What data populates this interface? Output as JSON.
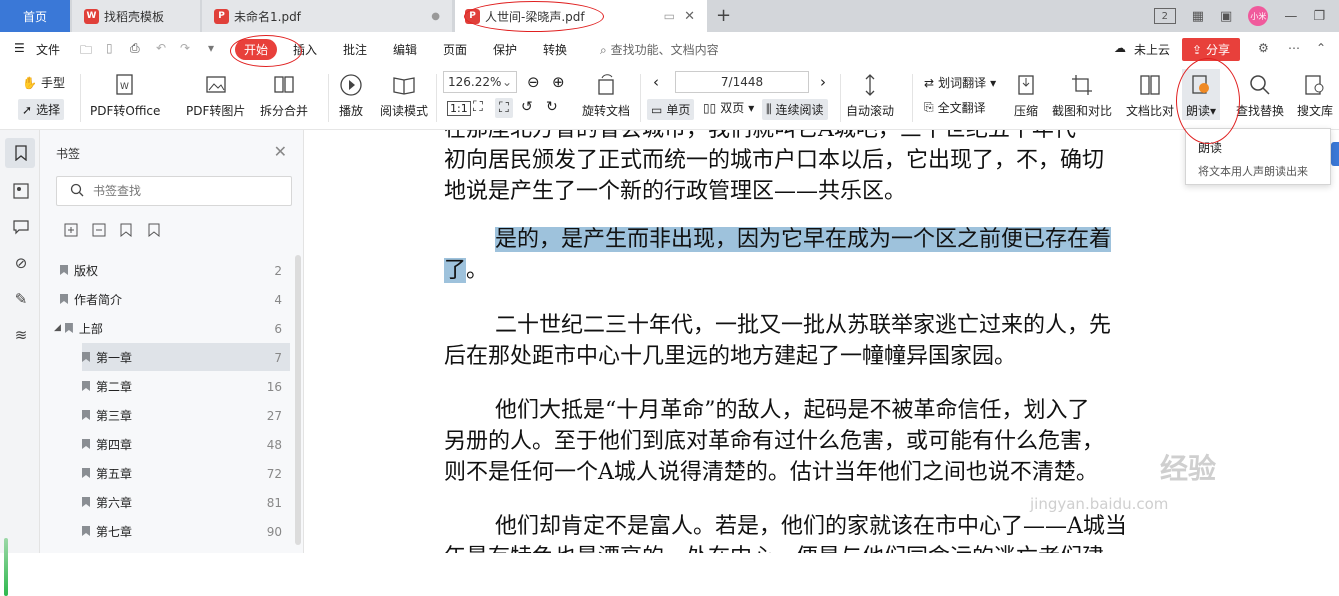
{
  "tabs": {
    "home": "首页",
    "t1": "找稻壳模板",
    "t2": "未命名1.pdf",
    "t3": "人世间-梁晓声.pdf",
    "t1_icon": "W",
    "t2_icon": "P",
    "t3_icon": "P",
    "avatar_text": "小米",
    "page_count_badge": "2"
  },
  "menubar": {
    "file": "文件",
    "start": "开始",
    "insert": "插入",
    "annotate": "批注",
    "edit": "编辑",
    "page": "页面",
    "protect": "保护",
    "convert": "转换",
    "search": "查找功能、文档内容",
    "cloud": "未上云",
    "share": "分享"
  },
  "ribbon": {
    "hand": "手型",
    "select": "选择",
    "pdf_office": "PDF转Office",
    "pdf_image": "PDF转图片",
    "split_merge": "拆分合并",
    "play": "播放",
    "reading_mode": "阅读模式",
    "zoom": "126.22%",
    "rotate_doc": "旋转文档",
    "page_indicator": "7/1448",
    "single_page": "单页",
    "double_page": "双页",
    "continuous": "连续阅读",
    "auto_scroll": "自动滚动",
    "word_translate": "划词翻译",
    "full_translate": "全文翻译",
    "compress": "压缩",
    "screenshot_compare": "截图和对比",
    "text_compare": "文档比对",
    "read_aloud": "朗读",
    "find_replace": "查找替换",
    "search_lib": "搜文库"
  },
  "tooltip": {
    "title": "朗读",
    "desc": "将文本用人声朗读出来"
  },
  "sidepanel": {
    "title": "书签",
    "search_placeholder": "书签查找",
    "items": [
      {
        "label": "版权",
        "page": "2"
      },
      {
        "label": "作者简介",
        "page": "4"
      },
      {
        "label": "上部",
        "page": "6"
      },
      {
        "label": "第一章",
        "page": "7"
      },
      {
        "label": "第二章",
        "page": "16"
      },
      {
        "label": "第三章",
        "page": "27"
      },
      {
        "label": "第四章",
        "page": "48"
      },
      {
        "label": "第五章",
        "page": "72"
      },
      {
        "label": "第六章",
        "page": "81"
      },
      {
        "label": "第七章",
        "page": "90"
      }
    ]
  },
  "document": {
    "p0a": "在那座北方省的省会城市，我们就叫它A城吧，三十世纪五十年代",
    "p0b": "初向居民颁发了正式而统一的城市户口本以后，它出现了，不，确切",
    "p0c": "地说是产生了一个新的行政管理区——共乐区。",
    "p1a": "是的，是产生而非出现，因为它早在成为一个区之前便已存在着",
    "p1b": "了",
    "p1c": "。",
    "p2a": "二十世纪二三十年代，一批又一批从苏联举家逃亡过来的人，先",
    "p2b": "后在那处距市中心十几里远的地方建起了一幢幢异国家园。",
    "p3a": "他们大抵是“十月革命”的敌人，起码是不被革命信任，划入了",
    "p3b": "另册的人。至于他们到底对革命有过什么危害，或可能有什么危害，",
    "p3c": "则不是任何一个A城人说得清楚的。估计当年他们之间也说不清楚。",
    "p4a": "他们却肯定不是富人。若是，他们的家就该在市中心了——A城当",
    "p4b": "年最有特色也最漂亮的，处在中心，便是与他们同命运的逃亡者们建"
  },
  "watermark": {
    "brand": "经验",
    "url": "jingyan.baidu.com"
  },
  "colors": {
    "accent": "#3a78d7",
    "start_button": "#e8403b",
    "highlight": "#9ec2dc",
    "annotation_circle": "#e02020"
  }
}
